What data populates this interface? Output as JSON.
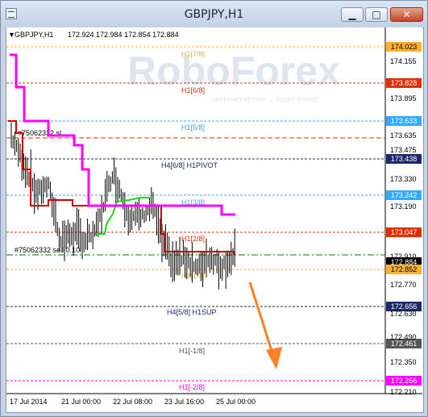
{
  "window": {
    "title": "GBPJPY,H1",
    "buttons": {
      "minimize": "▁",
      "maximize": "□",
      "close": "✕"
    }
  },
  "chart": {
    "info_header": {
      "symbol": "GBPJPY,H1",
      "quote": "172.924 172.984 172.854 172.884"
    },
    "watermark": {
      "brand": "RoboForex",
      "tagline": "ИНТЕРНЕТ-БРОКЕР — ЛИДЕР ФОРЕКС"
    },
    "colors": {
      "red_line": "#cc0000",
      "magenta_line": "#ff00ff",
      "green_line": "#11dd11",
      "price_bars": "#000000",
      "arrow": "#ff7f27"
    },
    "levels": [
      {
        "id": "h1-7-8",
        "label": "H1[7/8]",
        "price": "174.023",
        "color": "#ffb030",
        "style": "dash"
      },
      {
        "id": "h1-6-8",
        "label": "H1[6/8]",
        "price": "173.828",
        "color": "#e03000",
        "style": "dash"
      },
      {
        "id": "h1-5-8",
        "label": "H1[5/8]",
        "price": "173.633",
        "color": "#33aaff",
        "style": "dash"
      },
      {
        "id": "h4-6-8",
        "label": "H4[6/8] H1PIVOT",
        "price": "173.438",
        "color": "#1a2a6a",
        "style": "dash"
      },
      {
        "id": "h1-3-8",
        "label": "H1[3/8]",
        "price": "173.242",
        "color": "#33aaff",
        "style": "dash"
      },
      {
        "id": "h1-2-8",
        "label": "H1[2/8]",
        "price": "173.047",
        "color": "#e03000",
        "style": "dash"
      },
      {
        "id": "h1-1-8",
        "label": "H1[1/8]",
        "price": "172.852",
        "color": "#ffb030",
        "style": "dash"
      },
      {
        "id": "h4-5-8",
        "label": "H4[5/8] H1SUP",
        "price": "172.656",
        "color": "#1a2a6a",
        "style": "dash"
      },
      {
        "id": "h1-m1-8",
        "label": "H1[-1/8]",
        "price": "172.461",
        "color": "#555555",
        "style": "dash"
      },
      {
        "id": "h1-m2-8",
        "label": "H1[-2/8]",
        "price": "172.266",
        "color": "#ff00ff",
        "style": "dash"
      }
    ],
    "current_price": {
      "price": "172.884",
      "color": "#000000"
    },
    "order_lines": [
      {
        "id": "sl-line",
        "label": "#75062332 sl",
        "color": "#e03000"
      },
      {
        "id": "sell-line",
        "label": "#75062332 sell 0.10",
        "color": "#1a6a1a"
      }
    ],
    "y_ticks": [
      "174.155",
      "173.895",
      "173.635",
      "173.475",
      "173.330",
      "173.190",
      "172.910",
      "172.770",
      "172.630",
      "172.490",
      "172.350",
      "172.210"
    ],
    "x_ticks": [
      "17 Jul 2014",
      "21 Jul 00:00",
      "22 Jul 08:00",
      "23 Jul 16:00",
      "25 Jul 00:00"
    ]
  }
}
